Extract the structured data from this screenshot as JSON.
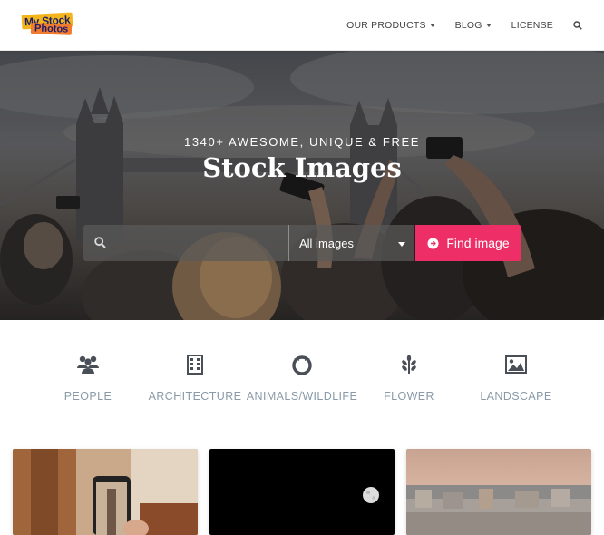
{
  "header": {
    "logo": {
      "line1": "My Stock",
      "line2": "Photos"
    },
    "nav": [
      {
        "label": "OUR PRODUCTS"
      },
      {
        "label": "BLOG"
      },
      {
        "label": "LICENSE"
      }
    ]
  },
  "hero": {
    "subtitle": "1340+ AWESOME, UNIQUE & FREE",
    "title": "Stock Images",
    "search": {
      "value": "",
      "placeholder": ""
    },
    "select": {
      "selected": "All images"
    },
    "button_label": "Find image"
  },
  "categories": [
    {
      "label": "PEOPLE",
      "icon": "people-icon"
    },
    {
      "label": "ARCHITECTURE",
      "icon": "building-icon"
    },
    {
      "label": "ANIMALS/WILDLIFE",
      "icon": "animal-icon"
    },
    {
      "label": "FLOWER",
      "icon": "leaf-icon"
    },
    {
      "label": "LANDSCAPE",
      "icon": "image-icon"
    }
  ],
  "colors": {
    "accent": "#ee2e66",
    "category_text": "#8a9aa8"
  }
}
